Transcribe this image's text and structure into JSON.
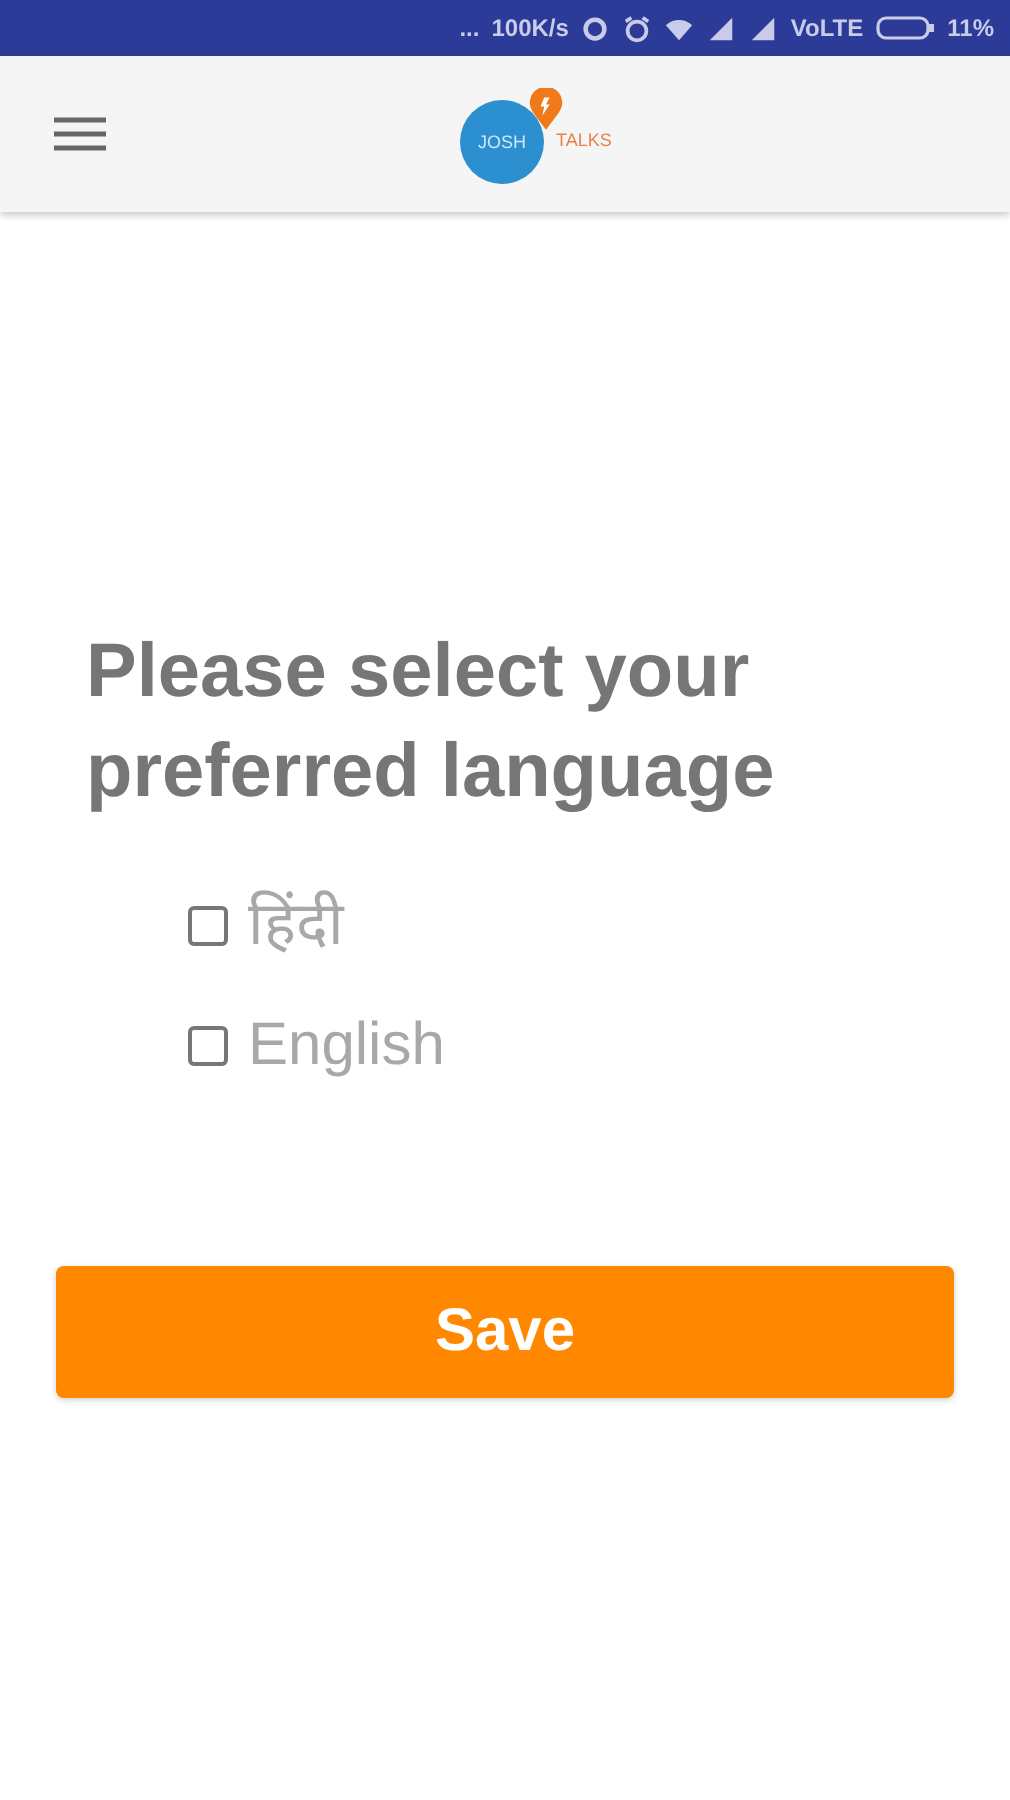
{
  "status_bar": {
    "dots": "...",
    "speed": "100K/s",
    "network": "VoLTE",
    "battery_percent": "11%"
  },
  "header": {
    "logo": {
      "word_1": "JOSH",
      "word_2": "TALKS"
    }
  },
  "title": "Please select your preferred language",
  "options": [
    {
      "label": "हिंदी",
      "checked": false
    },
    {
      "label": "English",
      "checked": false
    }
  ],
  "save_button": "Save"
}
